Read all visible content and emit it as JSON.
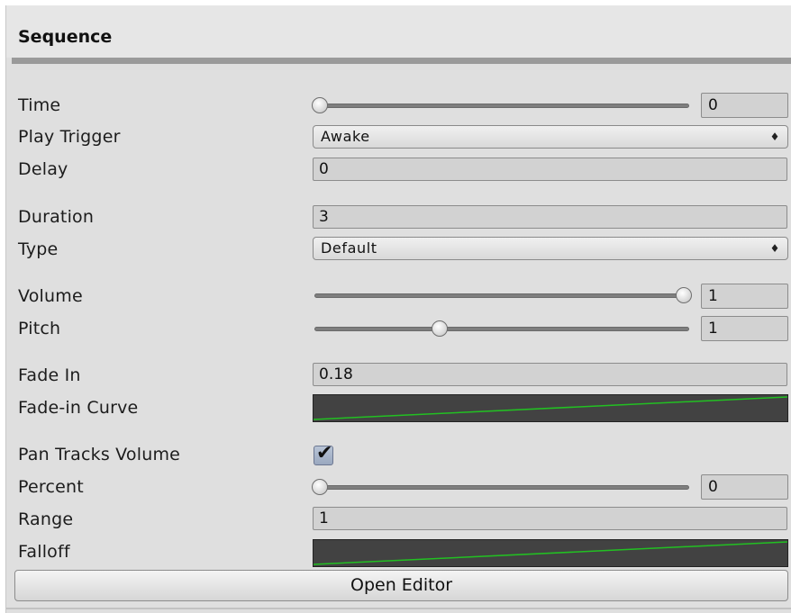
{
  "header": {
    "title": "Sequence"
  },
  "rows": {
    "time": {
      "label": "Time",
      "value": "0",
      "slider_fraction": 0.0
    },
    "play_trigger": {
      "label": "Play Trigger",
      "selected": "Awake"
    },
    "delay": {
      "label": "Delay",
      "value": "0"
    },
    "duration": {
      "label": "Duration",
      "value": "3"
    },
    "type": {
      "label": "Type",
      "selected": "Default"
    },
    "volume": {
      "label": "Volume",
      "value": "1",
      "slider_fraction": 1.0
    },
    "pitch": {
      "label": "Pitch",
      "value": "1",
      "slider_fraction": 0.33
    },
    "fade_in": {
      "label": "Fade In",
      "value": "0.18"
    },
    "fade_in_curve": {
      "label": "Fade-in Curve"
    },
    "pan_tracks_volume": {
      "label": "Pan Tracks Volume",
      "checked": true
    },
    "percent": {
      "label": "Percent",
      "value": "0",
      "slider_fraction": 0.0
    },
    "range": {
      "label": "Range",
      "value": "1"
    },
    "falloff": {
      "label": "Falloff"
    }
  },
  "icons": {
    "popup_arrows": "⇕ up-down-arrows-icon",
    "checkmark": "checkmark-icon"
  },
  "glyphs": {
    "popup_arrows": "♦",
    "check": "✔"
  },
  "colors": {
    "curve_line": "#22c022",
    "curve_bg": "#424242",
    "checkbox": "#a9b6cb"
  },
  "button": {
    "label": "Open Editor"
  }
}
